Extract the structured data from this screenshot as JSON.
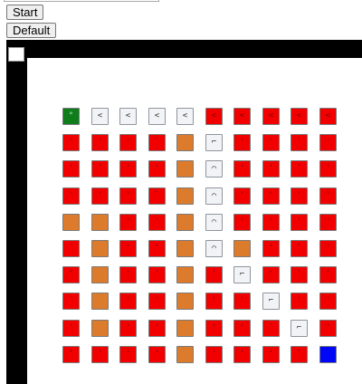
{
  "controls": {
    "start_label": "Start",
    "default_label": "Default"
  },
  "board": {
    "rows": 10,
    "cols": 10,
    "cells": [
      [
        {
          "c": "green",
          "s": "°"
        },
        {
          "c": "white",
          "s": "<"
        },
        {
          "c": "white",
          "s": "<"
        },
        {
          "c": "white",
          "s": "<"
        },
        {
          "c": "white",
          "s": "<"
        },
        {
          "c": "red",
          "s": "<"
        },
        {
          "c": "red",
          "s": "<"
        },
        {
          "c": "red",
          "s": "<"
        },
        {
          "c": "red",
          "s": "<"
        },
        {
          "c": "red",
          "s": "<"
        }
      ],
      [
        {
          "c": "red",
          "s": "'"
        },
        {
          "c": "red",
          "s": "'"
        },
        {
          "c": "red",
          "s": "'"
        },
        {
          "c": "red",
          "s": "`"
        },
        {
          "c": "orange",
          "s": ""
        },
        {
          "c": "white",
          "s": "⌐"
        },
        {
          "c": "red",
          "s": "'"
        },
        {
          "c": "red",
          "s": "'"
        },
        {
          "c": "red",
          "s": "`"
        },
        {
          "c": "red",
          "s": "'"
        }
      ],
      [
        {
          "c": "red",
          "s": "'"
        },
        {
          "c": "red",
          "s": "'"
        },
        {
          "c": "red",
          "s": "'"
        },
        {
          "c": "red",
          "s": "'"
        },
        {
          "c": "orange",
          "s": ""
        },
        {
          "c": "white",
          "s": "⌒"
        },
        {
          "c": "red",
          "s": "'"
        },
        {
          "c": "red",
          "s": "'"
        },
        {
          "c": "red",
          "s": "'"
        },
        {
          "c": "red",
          "s": "'"
        }
      ],
      [
        {
          "c": "red",
          "s": "'"
        },
        {
          "c": "red",
          "s": "'"
        },
        {
          "c": "red",
          "s": "'"
        },
        {
          "c": "red",
          "s": "`"
        },
        {
          "c": "orange",
          "s": ""
        },
        {
          "c": "white",
          "s": "⌒"
        },
        {
          "c": "red",
          "s": "'"
        },
        {
          "c": "red",
          "s": "'"
        },
        {
          "c": "red",
          "s": "'"
        },
        {
          "c": "red",
          "s": "'"
        }
      ],
      [
        {
          "c": "orange",
          "s": ""
        },
        {
          "c": "orange",
          "s": ""
        },
        {
          "c": "red",
          "s": "'"
        },
        {
          "c": "red",
          "s": "'"
        },
        {
          "c": "orange",
          "s": ""
        },
        {
          "c": "white",
          "s": "⌒"
        },
        {
          "c": "red",
          "s": "'"
        },
        {
          "c": "red",
          "s": "'"
        },
        {
          "c": "red",
          "s": "'"
        },
        {
          "c": "red",
          "s": "'"
        }
      ],
      [
        {
          "c": "red",
          "s": "`"
        },
        {
          "c": "orange",
          "s": ""
        },
        {
          "c": "red",
          "s": "'"
        },
        {
          "c": "red",
          "s": "'"
        },
        {
          "c": "orange",
          "s": ""
        },
        {
          "c": "white",
          "s": "⌒"
        },
        {
          "c": "orange",
          "s": ""
        },
        {
          "c": "red",
          "s": "'"
        },
        {
          "c": "red",
          "s": "`"
        },
        {
          "c": "red",
          "s": "'"
        }
      ],
      [
        {
          "c": "red",
          "s": "'"
        },
        {
          "c": "orange",
          "s": ""
        },
        {
          "c": "red",
          "s": "'"
        },
        {
          "c": "red",
          "s": "'"
        },
        {
          "c": "orange",
          "s": ""
        },
        {
          "c": "red",
          "s": "'"
        },
        {
          "c": "white",
          "s": "⌐"
        },
        {
          "c": "red",
          "s": "'"
        },
        {
          "c": "red",
          "s": "'"
        },
        {
          "c": "red",
          "s": "'"
        }
      ],
      [
        {
          "c": "red",
          "s": "`"
        },
        {
          "c": "orange",
          "s": ""
        },
        {
          "c": "red",
          "s": "'"
        },
        {
          "c": "red",
          "s": "'"
        },
        {
          "c": "orange",
          "s": ""
        },
        {
          "c": "red",
          "s": "'"
        },
        {
          "c": "red",
          "s": "'"
        },
        {
          "c": "white",
          "s": "⌐"
        },
        {
          "c": "red",
          "s": "'"
        },
        {
          "c": "red",
          "s": "'"
        }
      ],
      [
        {
          "c": "red",
          "s": "'"
        },
        {
          "c": "orange",
          "s": ""
        },
        {
          "c": "red",
          "s": "'"
        },
        {
          "c": "red",
          "s": "'"
        },
        {
          "c": "orange",
          "s": ""
        },
        {
          "c": "red",
          "s": "'"
        },
        {
          "c": "red",
          "s": "'"
        },
        {
          "c": "red",
          "s": "`"
        },
        {
          "c": "white",
          "s": "⌐"
        },
        {
          "c": "red",
          "s": "'"
        }
      ],
      [
        {
          "c": "red",
          "s": "'"
        },
        {
          "c": "red",
          "s": "'"
        },
        {
          "c": "red",
          "s": "'"
        },
        {
          "c": "red",
          "s": "'"
        },
        {
          "c": "orange",
          "s": ""
        },
        {
          "c": "red",
          "s": "'"
        },
        {
          "c": "red",
          "s": "'"
        },
        {
          "c": "red",
          "s": "'"
        },
        {
          "c": "red",
          "s": "`"
        },
        {
          "c": "blue",
          "s": ""
        }
      ]
    ]
  },
  "colors": {
    "red": "#f20000",
    "orange": "#dd7b2c",
    "white": "#f1f3f6",
    "green": "#0e7d1a",
    "blue": "#0007f6",
    "frame": "#000000"
  }
}
